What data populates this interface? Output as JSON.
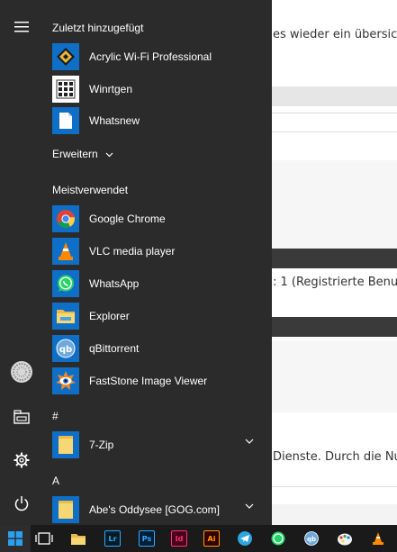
{
  "background": {
    "line1": "es wieder ein übersic",
    "line2": ": 1 (Registrierte Benu",
    "line3": "Dienste. Durch die Nut"
  },
  "start_menu": {
    "recent_header": "Zuletzt hinzugefügt",
    "recent": [
      {
        "label": "Acrylic Wi-Fi Professional",
        "icon": "acrylic-wifi-icon"
      },
      {
        "label": "Winrtgen",
        "icon": "winrtgen-icon"
      },
      {
        "label": "Whatsnew",
        "icon": "document-icon"
      }
    ],
    "expand_label": "Erweitern",
    "most_used_header": "Meistverwendet",
    "most_used": [
      {
        "label": "Google Chrome",
        "icon": "chrome-icon"
      },
      {
        "label": "VLC media player",
        "icon": "vlc-icon"
      },
      {
        "label": "WhatsApp",
        "icon": "whatsapp-icon"
      },
      {
        "label": "Explorer",
        "icon": "folder-icon"
      },
      {
        "label": "qBittorrent",
        "icon": "qbittorrent-icon"
      },
      {
        "label": "FastStone Image Viewer",
        "icon": "faststone-icon"
      }
    ],
    "hash_header": "#",
    "hash_items": [
      {
        "label": "7-Zip",
        "icon": "folder-icon"
      }
    ],
    "a_header": "A",
    "a_items": [
      {
        "label": "Abe's Oddysee [GOG.com]",
        "icon": "folder-icon"
      }
    ]
  },
  "taskbar": {
    "items": [
      "windows-start-icon",
      "task-view-icon",
      "file-explorer-icon",
      "lightroom-icon",
      "photoshop-icon",
      "indesign-icon",
      "illustrator-icon",
      "telegram-icon",
      "whatsapp-icon",
      "qbittorrent-icon",
      "paint-icon",
      "vlc-icon"
    ],
    "labels": {
      "lightroom": "Lr",
      "photoshop": "Ps",
      "indesign": "Id",
      "illustrator": "Ai"
    }
  },
  "colors": {
    "menu_bg": "#2b2b2b",
    "tile_blue": "#0f6fc6",
    "taskbar_bg": "#1a1a1a",
    "accent": "#0078d7"
  }
}
